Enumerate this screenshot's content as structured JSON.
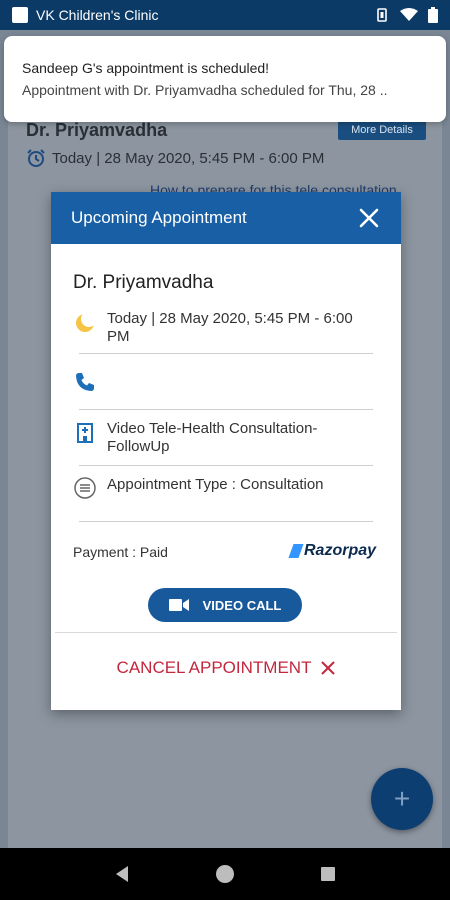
{
  "status_bar": {
    "app_name": "VK Children's Clinic"
  },
  "background": {
    "doctor_name": "Dr. Priyamvadha",
    "more_details_label": "More Details",
    "datetime": "Today | 28 May 2020, 5:45 PM - 6:00 PM",
    "prepare_link": "How to prepare for this tele consultation"
  },
  "notification": {
    "title": "Sandeep G's appointment is scheduled!",
    "body": "Appointment with Dr. Priyamvadha  scheduled for Thu, 28 .."
  },
  "dialog": {
    "title": "Upcoming Appointment",
    "doctor_name": "Dr. Priyamvadha",
    "datetime": "Today | 28 May 2020, 5:45 PM - 6:00 PM",
    "service": "Video Tele-Health Consultation-FollowUp",
    "appointment_type": "Appointment Type : Consultation",
    "payment": "Payment : Paid",
    "payment_provider": "Razorpay",
    "video_call_label": "VIDEO CALL",
    "cancel_label": "CANCEL APPOINTMENT"
  },
  "colors": {
    "header_blue": "#185fa6",
    "button_blue": "#17599a",
    "cancel_red": "#c2273d"
  }
}
